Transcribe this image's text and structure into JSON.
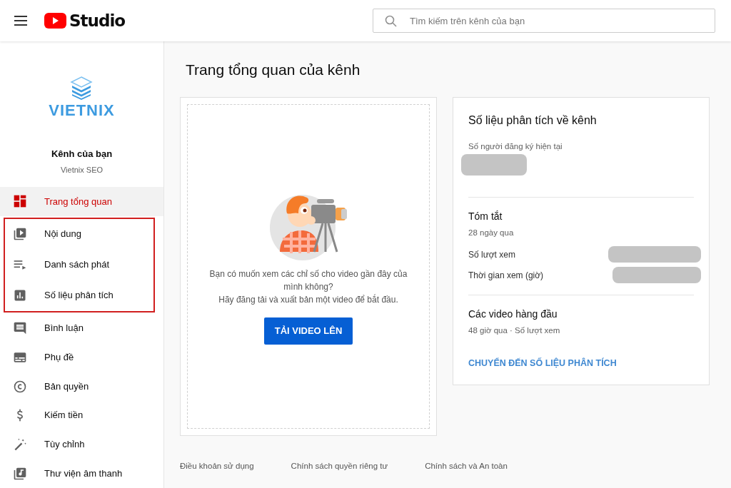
{
  "header": {
    "logo_text": "Studio",
    "search": {
      "placeholder": "Tìm kiếm trên kênh của bạn"
    }
  },
  "sidebar": {
    "logo_text": "VIETNIX",
    "channel_label": "Kênh của bạn",
    "channel_name": "Vietnix SEO",
    "items": [
      {
        "label": "Trang tổng quan",
        "selected": true,
        "highlighted": false
      },
      {
        "label": "Nội dung",
        "selected": false,
        "highlighted": true
      },
      {
        "label": "Danh sách phát",
        "selected": false,
        "highlighted": true
      },
      {
        "label": "Số liệu phân tích",
        "selected": false,
        "highlighted": true
      },
      {
        "label": "Bình luận",
        "selected": false,
        "highlighted": false
      },
      {
        "label": "Phụ đề",
        "selected": false,
        "highlighted": false
      },
      {
        "label": "Bản quyền",
        "selected": false,
        "highlighted": false
      },
      {
        "label": "Kiếm tiền",
        "selected": false,
        "highlighted": false
      },
      {
        "label": "Tùy chỉnh",
        "selected": false,
        "highlighted": false
      },
      {
        "label": "Thư viện âm thanh",
        "selected": false,
        "highlighted": false
      }
    ]
  },
  "page_title": "Trang tổng quan của kênh",
  "upload_card": {
    "message_line_1": "Bạn có muốn xem các chỉ số cho video gần đây của mình không?",
    "message_line_2": "Hãy đăng tải và xuất bản một video để bắt đầu.",
    "button": "TẢI VIDEO LÊN"
  },
  "analytics_card": {
    "title": "Số liệu phân tích về kênh",
    "subscribers_label": "Số người đăng ký hiện tại",
    "summary": {
      "title": "Tóm tắt",
      "period": "28 ngày qua",
      "rows": [
        {
          "label": "Số lượt xem"
        },
        {
          "label": "Thời gian xem (giờ)"
        }
      ]
    },
    "top_videos": {
      "title": "Các video hàng đầu",
      "period": "48 giờ qua · Số lượt xem"
    },
    "link": "CHUYỂN ĐẾN SỐ LIỆU PHÂN TÍCH"
  },
  "footer_links": [
    "Điều khoản sử dụng",
    "Chính sách quyền riêng tư",
    "Chính sách và An toàn"
  ]
}
